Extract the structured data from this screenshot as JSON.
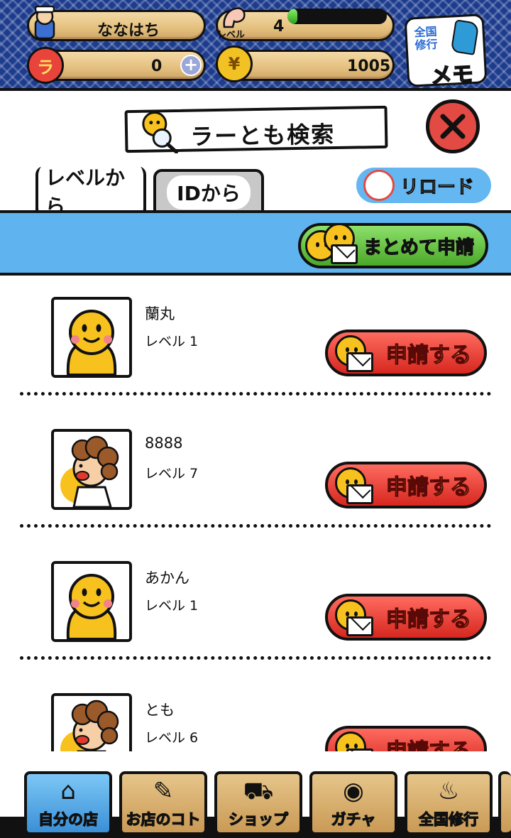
{
  "header": {
    "player_name": "ななはち",
    "level_label": "レベル",
    "level": "4",
    "level_progress": 0.1,
    "ramen_coins": "0",
    "money": "1005",
    "memo_badge_top": "全国\n修行",
    "memo_badge_bottom": "メモ"
  },
  "title": {
    "text": "ラーとも検索"
  },
  "tabs": [
    {
      "label": "レベルから",
      "active": true
    },
    {
      "label": "IDから",
      "active": false
    }
  ],
  "reload_label": "リロード",
  "bulk_apply_label": "まとめて申請",
  "apply_label": "申請する",
  "users": [
    {
      "name": "蘭丸",
      "level": "レベル 1",
      "avatar": "chick"
    },
    {
      "name": "8888",
      "level": "レベル 7",
      "avatar": "curly-hair"
    },
    {
      "name": "あかん",
      "level": "レベル 1",
      "avatar": "chick"
    },
    {
      "name": "とも",
      "level": "レベル 6",
      "avatar": "curly-hair"
    }
  ],
  "nav": [
    {
      "label": "自分の店",
      "icon": "house-icon",
      "active": true
    },
    {
      "label": "お店のコト",
      "icon": "shop-info-icon",
      "active": false
    },
    {
      "label": "ショップ",
      "icon": "basket-icon",
      "active": false
    },
    {
      "label": "ガチャ",
      "icon": "gacha-icon",
      "active": false
    },
    {
      "label": "全国修行",
      "icon": "ramen-map-icon",
      "active": false
    }
  ],
  "colors": {
    "header_bg": "#1d3c8e",
    "band_blue": "#5fb4ef",
    "apply_red": "#e34a44",
    "bulk_green": "#4aa82a"
  }
}
